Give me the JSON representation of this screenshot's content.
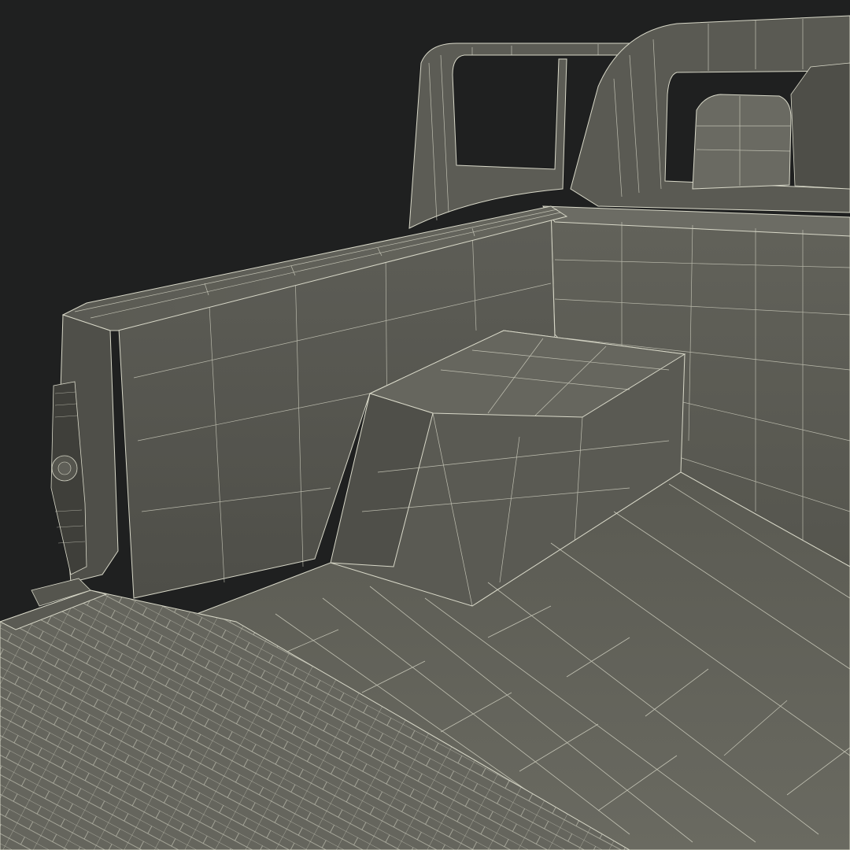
{
  "scene": {
    "subject": "pickup-truck-bed-wireframe-render",
    "colors": {
      "background": "#1f2020",
      "surface_light": "#6e6e66",
      "surface_mid": "#5e5e57",
      "surface_dark": "#4a4a44",
      "floor": "#626259",
      "wire": "#d8d8c8"
    }
  }
}
